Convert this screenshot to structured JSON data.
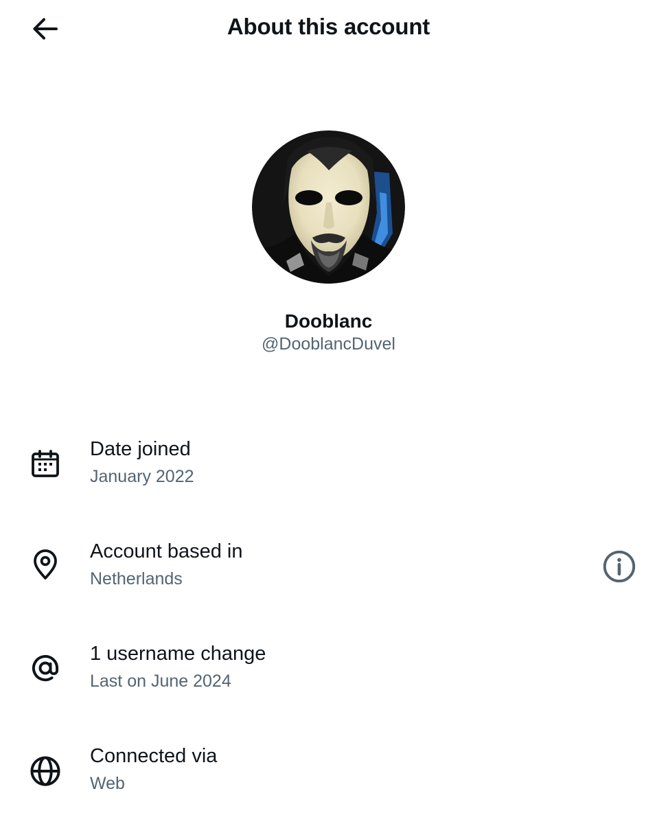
{
  "header": {
    "title": "About this account",
    "back_icon": "arrow-left-icon"
  },
  "profile": {
    "display_name": "Dooblanc",
    "handle": "@DooblancDuvel",
    "avatar": "profile-photo"
  },
  "details": [
    {
      "icon": "calendar-icon",
      "title": "Date joined",
      "subtitle": "January 2022"
    },
    {
      "icon": "location-pin-icon",
      "title": "Account based in",
      "subtitle": "Netherlands",
      "trailing_icon": "info-icon"
    },
    {
      "icon": "at-sign-icon",
      "title": "1 username change",
      "subtitle": "Last on June 2024"
    },
    {
      "icon": "globe-icon",
      "title": "Connected via",
      "subtitle": "Web"
    }
  ],
  "colors": {
    "primary_text": "#0f1419",
    "secondary_text": "#536471",
    "background": "#ffffff"
  }
}
